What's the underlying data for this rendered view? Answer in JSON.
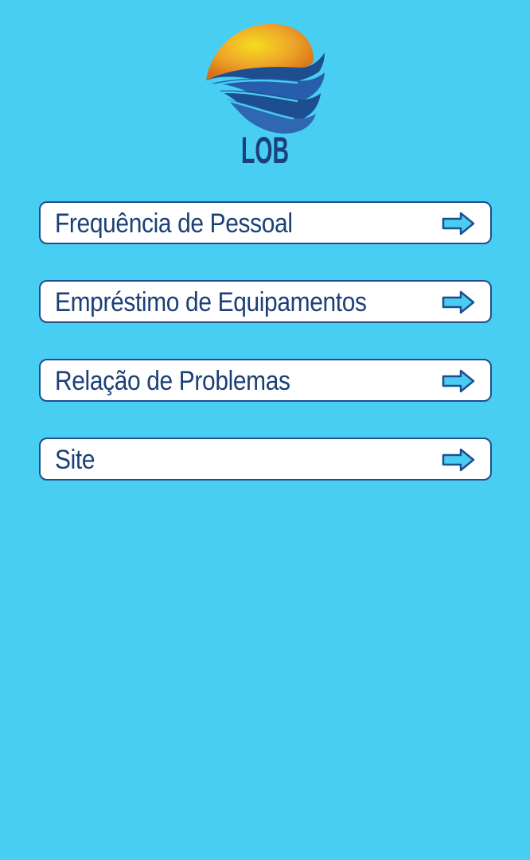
{
  "app": {
    "logo_text": "LOB",
    "brand_colors": {
      "background": "#48cdf3",
      "navy": "#1b3f78",
      "sun_light": "#f6dc1f",
      "sun_dark": "#d66f17",
      "wave_blue": "#2f67b2"
    }
  },
  "menu": {
    "items": [
      {
        "label": "Frequência de Pessoal",
        "icon": "arrow-right-icon"
      },
      {
        "label": "Empréstimo de Equipamentos",
        "icon": "arrow-right-icon"
      },
      {
        "label": "Relação de Problemas",
        "icon": "arrow-right-icon"
      },
      {
        "label": "Site",
        "icon": "arrow-right-icon"
      }
    ]
  }
}
